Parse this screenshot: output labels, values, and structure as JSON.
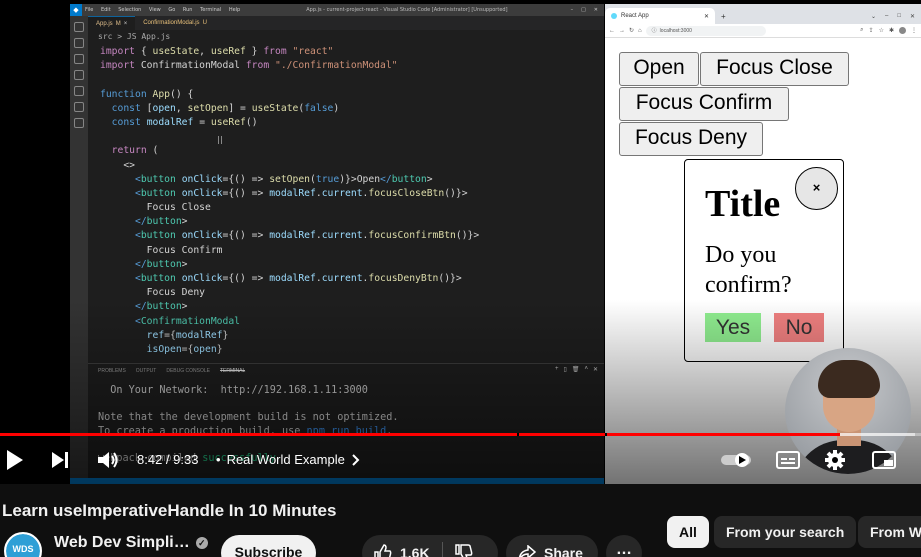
{
  "vscode": {
    "menu": [
      "File",
      "Edit",
      "Selection",
      "View",
      "Go",
      "Run",
      "Terminal",
      "Help"
    ],
    "window_title": "App.js - current-project-react - Visual Studio Code [Administrator] [Unsupported]",
    "tabs": [
      {
        "label": "App.js",
        "badge": "M"
      },
      {
        "label": "ConfirmationModal.js",
        "badge": "U"
      }
    ],
    "breadcrumb": "src > JS App.js",
    "code_lines": [
      "import { useState, useRef } from \"react\"",
      "import ConfirmationModal from \"./ConfirmationModal\"",
      "",
      "function App() {",
      "  const [open, setOpen] = useState(false)",
      "  const modalRef = useRef()",
      "",
      "  return (",
      "    <>",
      "      <button onClick={() => setOpen(true)}>Open</button>",
      "      <button onClick={() => modalRef.current.focusCloseBtn()}>",
      "        Focus Close",
      "      </button>",
      "      <button onClick={() => modalRef.current.focusConfirmBtn()}>",
      "        Focus Confirm",
      "      </button>",
      "      <button onClick={() => modalRef.current.focusDenyBtn()}>",
      "        Focus Deny",
      "      </button>",
      "      <ConfirmationModal",
      "        ref={modalRef}",
      "        isOpen={open}"
    ],
    "panel_tabs": [
      "PROBLEMS",
      "OUTPUT",
      "DEBUG CONSOLE",
      "TERMINAL"
    ],
    "terminal_lines": [
      "  On Your Network:  http://192.168.1.11:3000",
      "",
      "Note that the development build is not optimized.",
      "To create a production build, use npm run build.",
      "",
      "webpack compiled successfully"
    ]
  },
  "browser": {
    "tab_title": "React App",
    "url": "localhost:3000",
    "buttons": [
      "Open",
      "Focus Close",
      "Focus Confirm",
      "Focus Deny"
    ],
    "modal": {
      "close_label": "×",
      "title": "Title",
      "body": "Do you confirm?",
      "yes_label": "Yes",
      "no_label": "No"
    }
  },
  "player": {
    "time": "8:42 / 9:33",
    "chapter": "Real World Example",
    "progress_fraction": 0.912,
    "buffer_fraction": 0.994
  },
  "video": {
    "title": "Learn useImperativeHandle In 10 Minutes",
    "channel_name": "Web Dev Simpli…",
    "channel_avatar_text": "WDS",
    "subscribe_label": "Subscribe",
    "likes": "1.6K",
    "share_label": "Share"
  },
  "chips": [
    "All",
    "From your search",
    "From We"
  ],
  "colors": {
    "youtube_red": "#ff0000",
    "vscode_blue": "#007acc",
    "yes_green": "#90ee90",
    "no_red": "#f08080"
  }
}
